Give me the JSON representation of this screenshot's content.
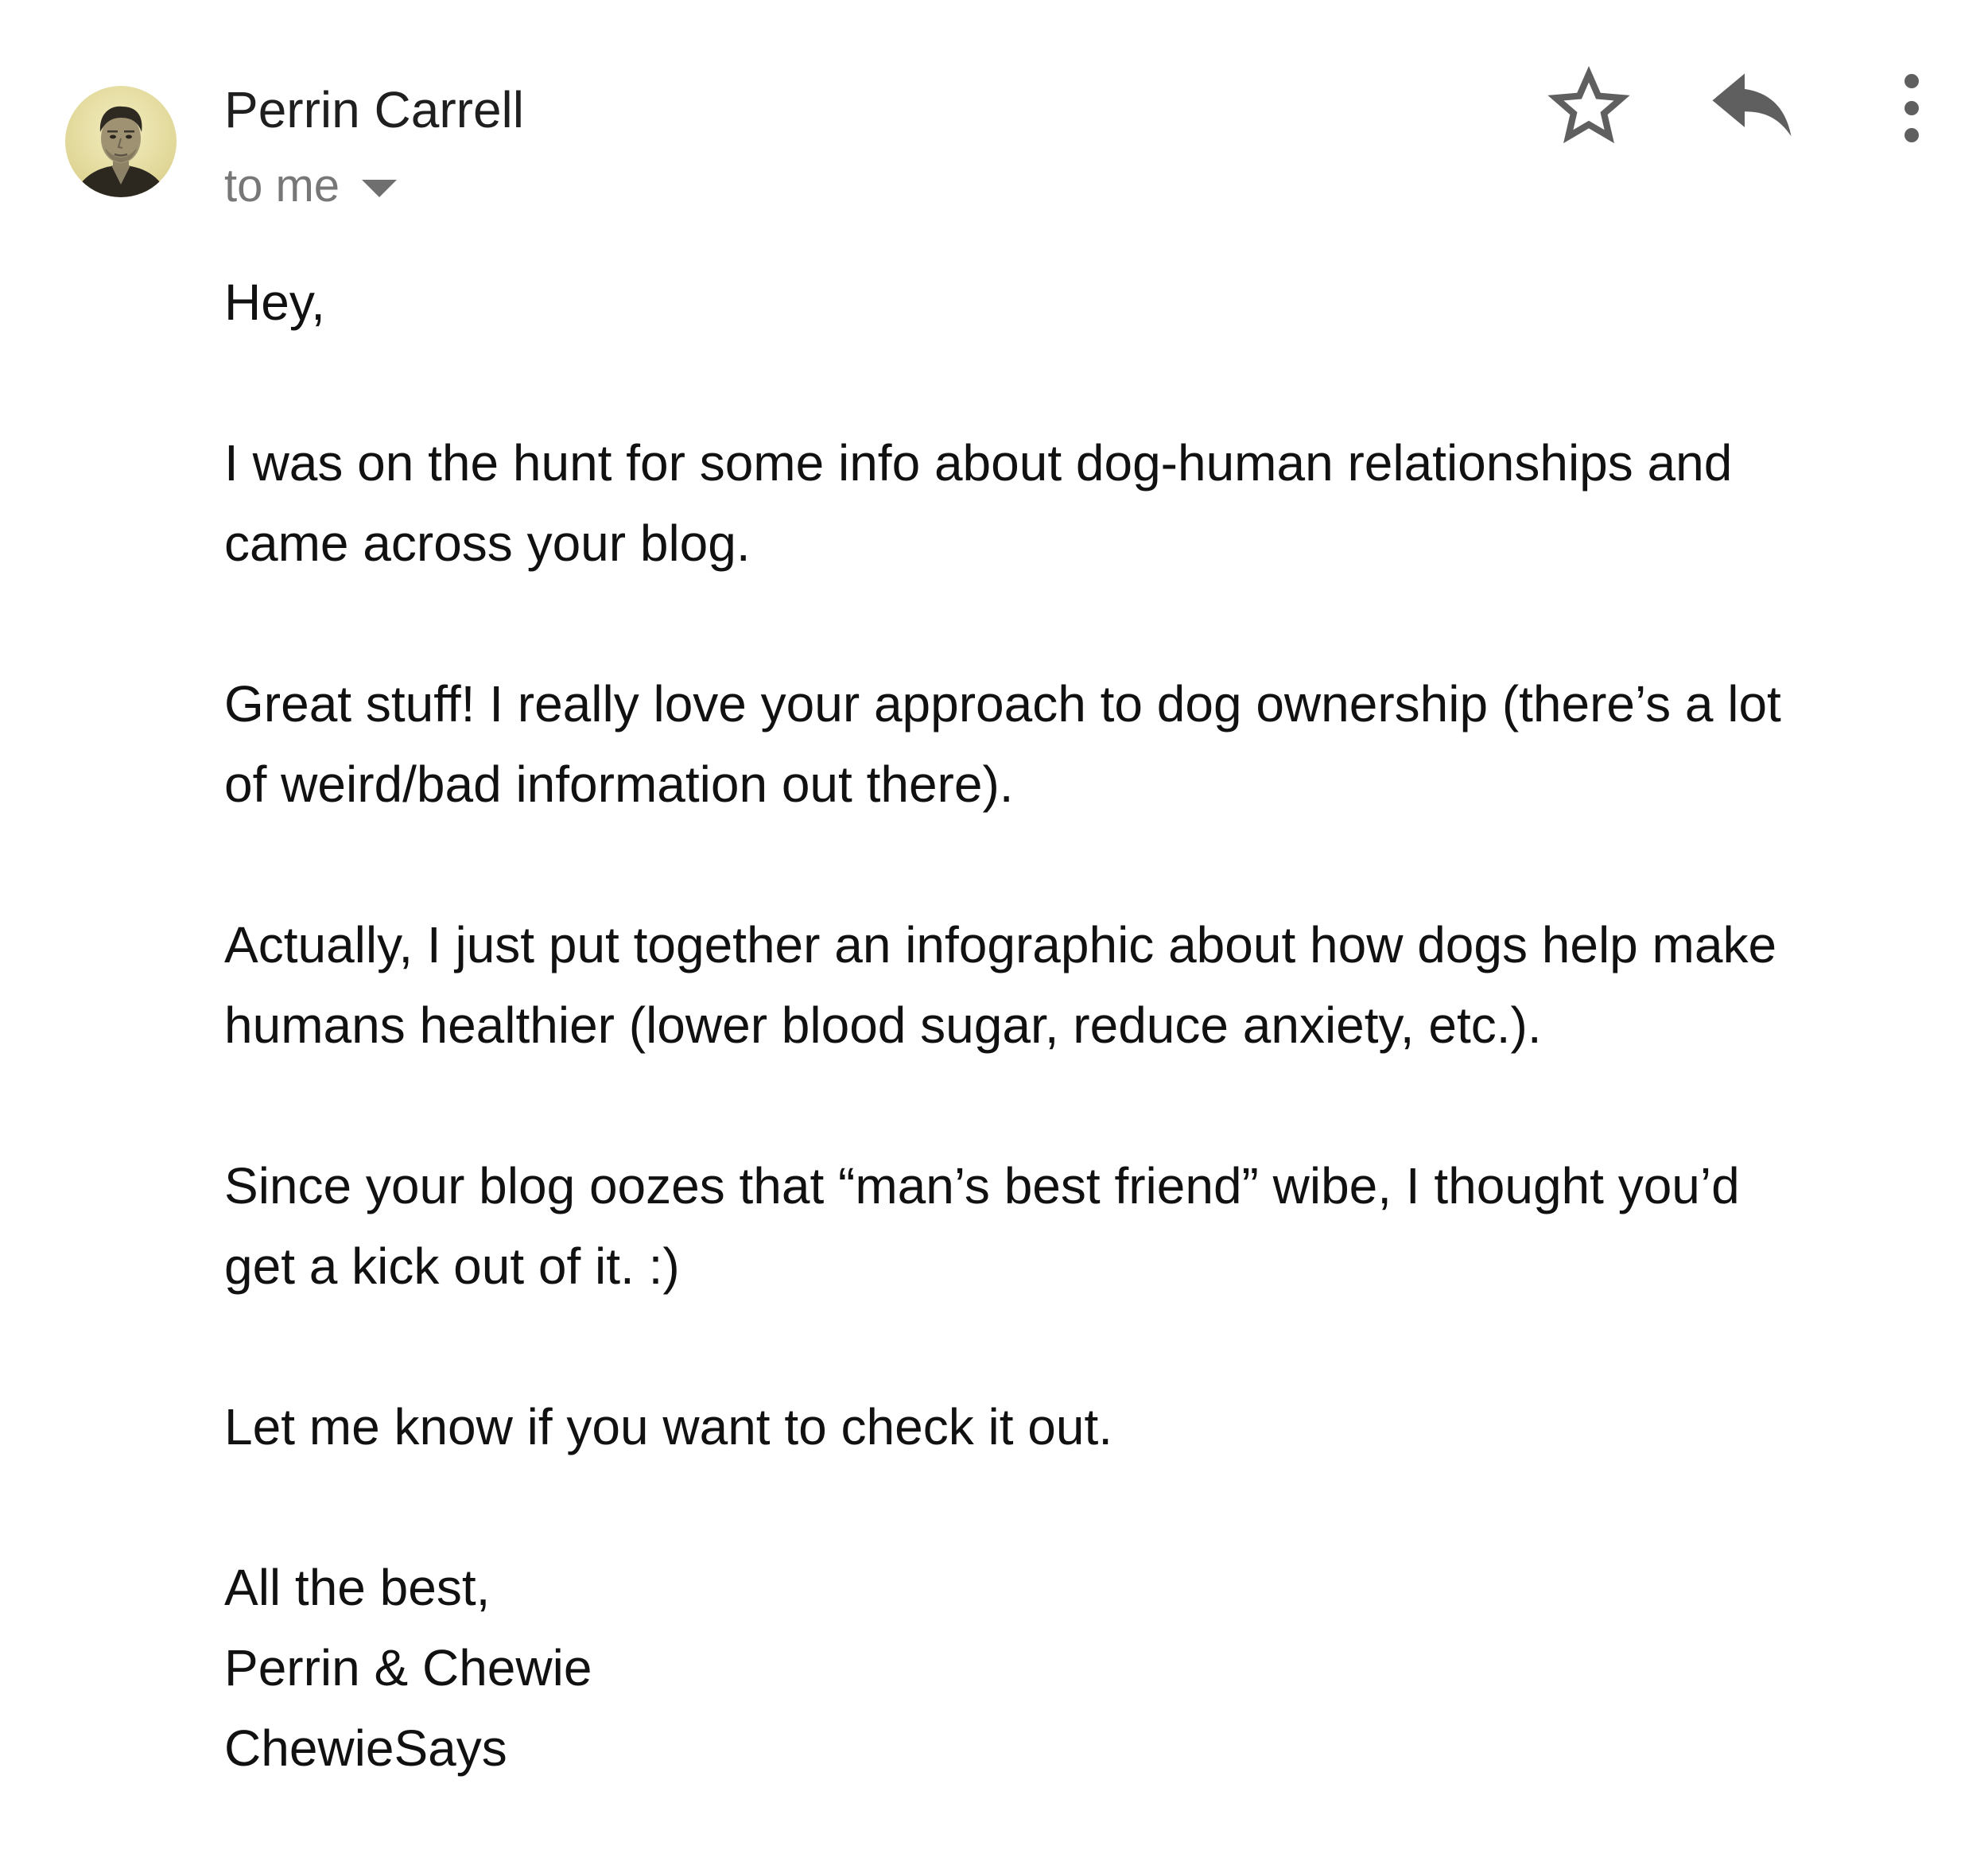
{
  "sender": {
    "name": "Perrin Carrell",
    "recipient_label": "to me"
  },
  "actions": {
    "star": "star-icon",
    "reply": "reply-icon",
    "more": "more-vertical-icon"
  },
  "message": {
    "greeting": "Hey,",
    "paragraph1": [
      "I was on the hunt for some info about dog-human relationships and",
      "came across your blog."
    ],
    "paragraph2": [
      "Great stuff! I really love your approach to dog ownership (there’s a lot",
      "of weird/bad information out there)."
    ],
    "paragraph3": [
      "Actually, I just put together an infographic about how dogs help make",
      "humans healthier (lower blood sugar, reduce anxiety, etc.)."
    ],
    "paragraph4": [
      "Since your blog oozes that “man’s best friend” wibe, I thought you’d",
      "get a kick out of it. :)"
    ],
    "paragraph5": "Let me know if you want to check it out.",
    "signature": [
      "All the best,",
      "Perrin & Chewie",
      "ChewieSays"
    ]
  }
}
